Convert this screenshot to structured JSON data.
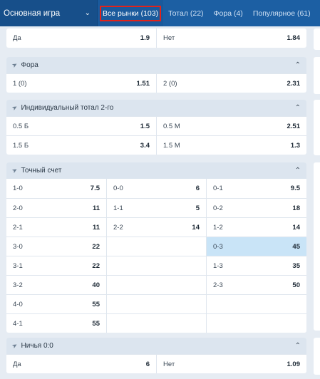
{
  "topbar": {
    "game_select": "Основная игра",
    "tabs": [
      {
        "label": "Все рынки (103)",
        "active": true
      },
      {
        "label": "Тотал (22)",
        "active": false
      },
      {
        "label": "Фора (4)",
        "active": false
      },
      {
        "label": "Популярное (61)",
        "active": false
      }
    ]
  },
  "both_score": {
    "rows": [
      [
        {
          "label": "Да",
          "odd": "1.9"
        },
        {
          "label": "Нет",
          "odd": "1.84"
        }
      ]
    ]
  },
  "handicap": {
    "title": "Фора",
    "rows": [
      [
        {
          "label": "1 (0)",
          "odd": "1.51"
        },
        {
          "label": "2 (0)",
          "odd": "2.31"
        }
      ]
    ]
  },
  "ind_total": {
    "title": "Индивидуальный тотал 2-го",
    "rows": [
      [
        {
          "label": "0.5 Б",
          "odd": "1.5"
        },
        {
          "label": "0.5 М",
          "odd": "2.51"
        }
      ],
      [
        {
          "label": "1.5 Б",
          "odd": "3.4"
        },
        {
          "label": "1.5 М",
          "odd": "1.3"
        }
      ]
    ]
  },
  "exact_score": {
    "title": "Точный счет",
    "rows": [
      [
        {
          "label": "1-0",
          "odd": "7.5"
        },
        {
          "label": "0-0",
          "odd": "6"
        },
        {
          "label": "0-1",
          "odd": "9.5"
        }
      ],
      [
        {
          "label": "2-0",
          "odd": "11"
        },
        {
          "label": "1-1",
          "odd": "5"
        },
        {
          "label": "0-2",
          "odd": "18"
        }
      ],
      [
        {
          "label": "2-1",
          "odd": "11"
        },
        {
          "label": "2-2",
          "odd": "14"
        },
        {
          "label": "1-2",
          "odd": "14"
        }
      ],
      [
        {
          "label": "3-0",
          "odd": "22"
        },
        {
          "label": "",
          "odd": ""
        },
        {
          "label": "0-3",
          "odd": "45",
          "selected": true
        }
      ],
      [
        {
          "label": "3-1",
          "odd": "22"
        },
        {
          "label": "",
          "odd": ""
        },
        {
          "label": "1-3",
          "odd": "35"
        }
      ],
      [
        {
          "label": "3-2",
          "odd": "40"
        },
        {
          "label": "",
          "odd": ""
        },
        {
          "label": "2-3",
          "odd": "50"
        }
      ],
      [
        {
          "label": "4-0",
          "odd": "55"
        },
        {
          "label": "",
          "odd": ""
        },
        {
          "label": "",
          "odd": ""
        }
      ],
      [
        {
          "label": "4-1",
          "odd": "55"
        },
        {
          "label": "",
          "odd": ""
        },
        {
          "label": "",
          "odd": ""
        }
      ]
    ]
  },
  "draw_00": {
    "title": "Ничья 0:0",
    "rows": [
      [
        {
          "label": "Да",
          "odd": "6"
        },
        {
          "label": "Нет",
          "odd": "1.09"
        }
      ]
    ]
  }
}
